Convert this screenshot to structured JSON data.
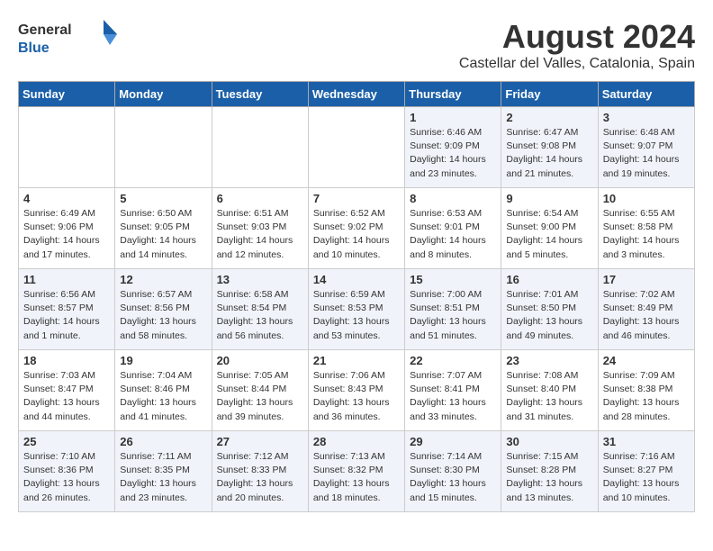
{
  "header": {
    "logo_general": "General",
    "logo_blue": "Blue",
    "main_title": "August 2024",
    "subtitle": "Castellar del Valles, Catalonia, Spain"
  },
  "weekdays": [
    "Sunday",
    "Monday",
    "Tuesday",
    "Wednesday",
    "Thursday",
    "Friday",
    "Saturday"
  ],
  "weeks": [
    [
      {
        "day": "",
        "info": ""
      },
      {
        "day": "",
        "info": ""
      },
      {
        "day": "",
        "info": ""
      },
      {
        "day": "",
        "info": ""
      },
      {
        "day": "1",
        "info": "Sunrise: 6:46 AM\nSunset: 9:09 PM\nDaylight: 14 hours\nand 23 minutes."
      },
      {
        "day": "2",
        "info": "Sunrise: 6:47 AM\nSunset: 9:08 PM\nDaylight: 14 hours\nand 21 minutes."
      },
      {
        "day": "3",
        "info": "Sunrise: 6:48 AM\nSunset: 9:07 PM\nDaylight: 14 hours\nand 19 minutes."
      }
    ],
    [
      {
        "day": "4",
        "info": "Sunrise: 6:49 AM\nSunset: 9:06 PM\nDaylight: 14 hours\nand 17 minutes."
      },
      {
        "day": "5",
        "info": "Sunrise: 6:50 AM\nSunset: 9:05 PM\nDaylight: 14 hours\nand 14 minutes."
      },
      {
        "day": "6",
        "info": "Sunrise: 6:51 AM\nSunset: 9:03 PM\nDaylight: 14 hours\nand 12 minutes."
      },
      {
        "day": "7",
        "info": "Sunrise: 6:52 AM\nSunset: 9:02 PM\nDaylight: 14 hours\nand 10 minutes."
      },
      {
        "day": "8",
        "info": "Sunrise: 6:53 AM\nSunset: 9:01 PM\nDaylight: 14 hours\nand 8 minutes."
      },
      {
        "day": "9",
        "info": "Sunrise: 6:54 AM\nSunset: 9:00 PM\nDaylight: 14 hours\nand 5 minutes."
      },
      {
        "day": "10",
        "info": "Sunrise: 6:55 AM\nSunset: 8:58 PM\nDaylight: 14 hours\nand 3 minutes."
      }
    ],
    [
      {
        "day": "11",
        "info": "Sunrise: 6:56 AM\nSunset: 8:57 PM\nDaylight: 14 hours\nand 1 minute."
      },
      {
        "day": "12",
        "info": "Sunrise: 6:57 AM\nSunset: 8:56 PM\nDaylight: 13 hours\nand 58 minutes."
      },
      {
        "day": "13",
        "info": "Sunrise: 6:58 AM\nSunset: 8:54 PM\nDaylight: 13 hours\nand 56 minutes."
      },
      {
        "day": "14",
        "info": "Sunrise: 6:59 AM\nSunset: 8:53 PM\nDaylight: 13 hours\nand 53 minutes."
      },
      {
        "day": "15",
        "info": "Sunrise: 7:00 AM\nSunset: 8:51 PM\nDaylight: 13 hours\nand 51 minutes."
      },
      {
        "day": "16",
        "info": "Sunrise: 7:01 AM\nSunset: 8:50 PM\nDaylight: 13 hours\nand 49 minutes."
      },
      {
        "day": "17",
        "info": "Sunrise: 7:02 AM\nSunset: 8:49 PM\nDaylight: 13 hours\nand 46 minutes."
      }
    ],
    [
      {
        "day": "18",
        "info": "Sunrise: 7:03 AM\nSunset: 8:47 PM\nDaylight: 13 hours\nand 44 minutes."
      },
      {
        "day": "19",
        "info": "Sunrise: 7:04 AM\nSunset: 8:46 PM\nDaylight: 13 hours\nand 41 minutes."
      },
      {
        "day": "20",
        "info": "Sunrise: 7:05 AM\nSunset: 8:44 PM\nDaylight: 13 hours\nand 39 minutes."
      },
      {
        "day": "21",
        "info": "Sunrise: 7:06 AM\nSunset: 8:43 PM\nDaylight: 13 hours\nand 36 minutes."
      },
      {
        "day": "22",
        "info": "Sunrise: 7:07 AM\nSunset: 8:41 PM\nDaylight: 13 hours\nand 33 minutes."
      },
      {
        "day": "23",
        "info": "Sunrise: 7:08 AM\nSunset: 8:40 PM\nDaylight: 13 hours\nand 31 minutes."
      },
      {
        "day": "24",
        "info": "Sunrise: 7:09 AM\nSunset: 8:38 PM\nDaylight: 13 hours\nand 28 minutes."
      }
    ],
    [
      {
        "day": "25",
        "info": "Sunrise: 7:10 AM\nSunset: 8:36 PM\nDaylight: 13 hours\nand 26 minutes."
      },
      {
        "day": "26",
        "info": "Sunrise: 7:11 AM\nSunset: 8:35 PM\nDaylight: 13 hours\nand 23 minutes."
      },
      {
        "day": "27",
        "info": "Sunrise: 7:12 AM\nSunset: 8:33 PM\nDaylight: 13 hours\nand 20 minutes."
      },
      {
        "day": "28",
        "info": "Sunrise: 7:13 AM\nSunset: 8:32 PM\nDaylight: 13 hours\nand 18 minutes."
      },
      {
        "day": "29",
        "info": "Sunrise: 7:14 AM\nSunset: 8:30 PM\nDaylight: 13 hours\nand 15 minutes."
      },
      {
        "day": "30",
        "info": "Sunrise: 7:15 AM\nSunset: 8:28 PM\nDaylight: 13 hours\nand 13 minutes."
      },
      {
        "day": "31",
        "info": "Sunrise: 7:16 AM\nSunset: 8:27 PM\nDaylight: 13 hours\nand 10 minutes."
      }
    ]
  ]
}
